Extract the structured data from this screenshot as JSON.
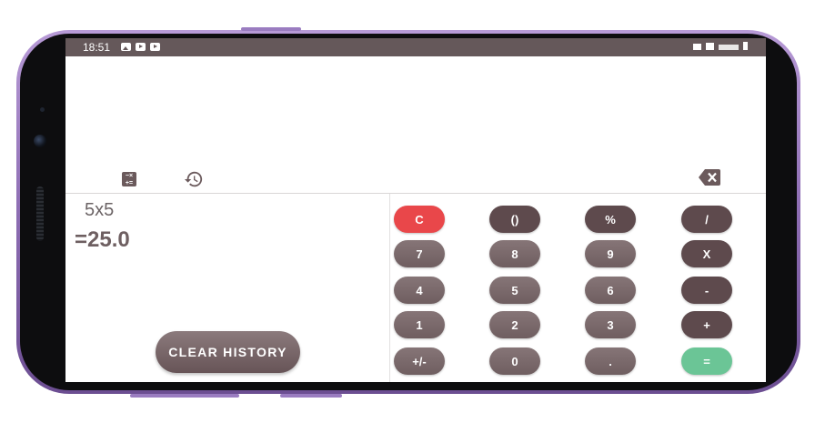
{
  "status_bar": {
    "time": "18:51",
    "left_icons": [
      "gallery-icon",
      "youtube-icon",
      "youtube-icon"
    ],
    "right_icons": [
      "mute-icon",
      "wifi-icon",
      "signal-icon",
      "battery-icon"
    ]
  },
  "toolbar": {
    "icons": [
      "calculator-icon",
      "history-icon",
      "backspace-icon"
    ],
    "calc_glyph": "−×\n+="
  },
  "display": {
    "expression": "5x5",
    "result": "=25.0"
  },
  "history": {
    "clear_label": "CLEAR HISTORY"
  },
  "keypad": {
    "rows": [
      [
        "C",
        "()",
        "%",
        "/"
      ],
      [
        "7",
        "8",
        "9",
        "X"
      ],
      [
        "4",
        "5",
        "6",
        "-"
      ],
      [
        "1",
        "2",
        "3",
        "+"
      ],
      [
        "+/-",
        "0",
        ".",
        "="
      ]
    ]
  },
  "colors": {
    "status_bar": "#65585a",
    "key_dark": "#5e4a4d",
    "key_gray": "#7a6a6c",
    "clear_key": "#e9474a",
    "equals_key": "#6bc596",
    "phone_frame": "#8d6db3"
  }
}
